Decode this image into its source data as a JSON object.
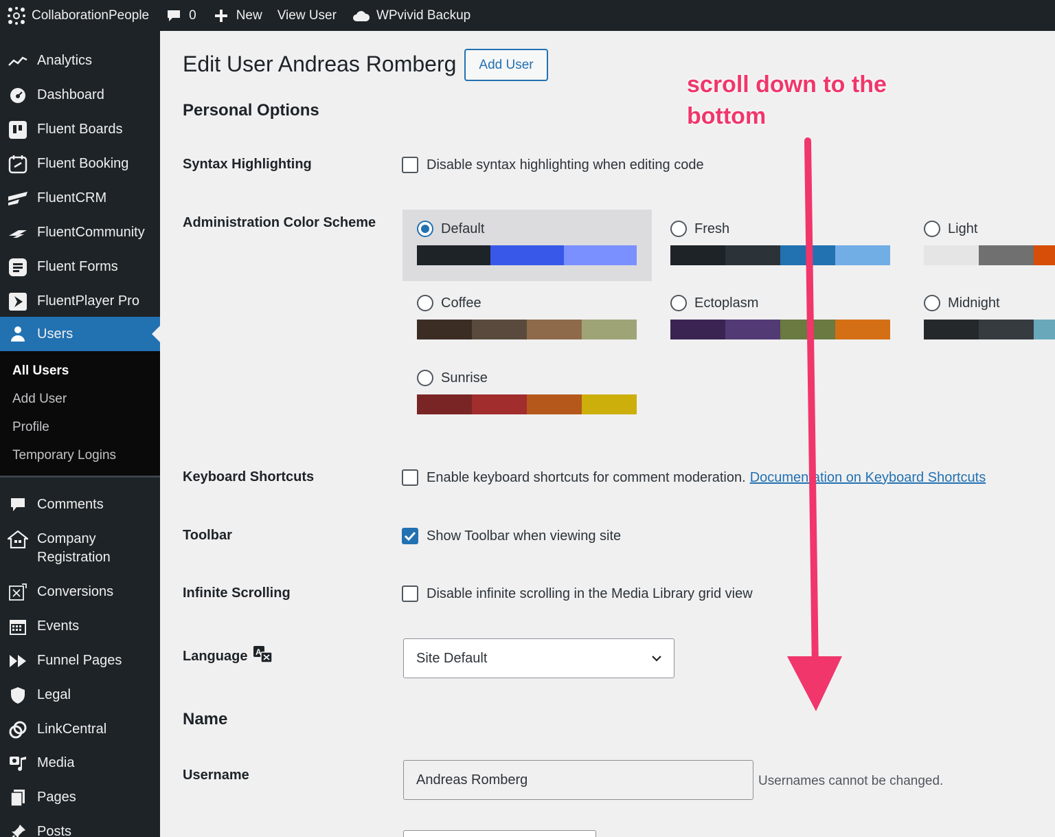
{
  "adminbar": {
    "site_name": "CollaborationPeople",
    "comments_count": "0",
    "new_label": "New",
    "view_user_label": "View User",
    "backup_label": "WPvivid Backup"
  },
  "sidebar": {
    "items": [
      {
        "label": "Analytics",
        "icon": "analytics-icon"
      },
      {
        "label": "Dashboard",
        "icon": "dashboard-icon"
      },
      {
        "label": "Fluent Boards",
        "icon": "fluent-boards-icon"
      },
      {
        "label": "Fluent Booking",
        "icon": "fluent-booking-icon"
      },
      {
        "label": "FluentCRM",
        "icon": "fluentcrm-icon"
      },
      {
        "label": "FluentCommunity",
        "icon": "fluentcommunity-icon"
      },
      {
        "label": "Fluent Forms",
        "icon": "fluent-forms-icon"
      },
      {
        "label": "FluentPlayer Pro",
        "icon": "fluentplayer-icon"
      },
      {
        "label": "Users",
        "icon": "users-icon"
      },
      {
        "label": "Comments",
        "icon": "comments-icon"
      },
      {
        "label": "Company Registration",
        "icon": "company-registration-icon"
      },
      {
        "label": "Conversions",
        "icon": "conversions-icon"
      },
      {
        "label": "Events",
        "icon": "events-icon"
      },
      {
        "label": "Funnel Pages",
        "icon": "funnel-pages-icon"
      },
      {
        "label": "Legal",
        "icon": "legal-icon"
      },
      {
        "label": "LinkCentral",
        "icon": "linkcentral-icon"
      },
      {
        "label": "Media",
        "icon": "media-icon"
      },
      {
        "label": "Pages",
        "icon": "pages-icon"
      },
      {
        "label": "Posts",
        "icon": "posts-icon"
      }
    ],
    "submenu": [
      "All Users",
      "Add User",
      "Profile",
      "Temporary Logins"
    ]
  },
  "page": {
    "title": "Edit User Andreas Romberg",
    "add_user_button": "Add User",
    "personal_options_heading": "Personal Options",
    "name_heading": "Name"
  },
  "options": {
    "syntax": {
      "label": "Syntax Highlighting",
      "text": "Disable syntax highlighting when editing code",
      "checked": false
    },
    "color_scheme_label": "Administration Color Scheme",
    "keyboard": {
      "label": "Keyboard Shortcuts",
      "text": "Enable keyboard shortcuts for comment moderation.",
      "link": "Documentation on Keyboard Shortcuts",
      "checked": false
    },
    "toolbar": {
      "label": "Toolbar",
      "text": "Show Toolbar when viewing site",
      "checked": true
    },
    "infinite": {
      "label": "Infinite Scrolling",
      "text": "Disable infinite scrolling in the Media Library grid view",
      "checked": false
    },
    "language": {
      "label": "Language",
      "value": "Site Default"
    },
    "username": {
      "label": "Username",
      "value": "Andreas Romberg",
      "hint": "Usernames cannot be changed."
    }
  },
  "color_schemes": [
    {
      "name": "Default",
      "selected": true,
      "colors": [
        "#1d2327",
        "#2c3338",
        "#2271b1",
        "#72aee6"
      ]
    },
    {
      "name": "Fresh",
      "selected": false,
      "colors": [
        "#1d2327",
        "#2c3338",
        "#2271b1",
        "#72aee6"
      ]
    },
    {
      "name": "Light",
      "selected": false,
      "colors": [
        "#e5e5e5",
        "#999999",
        "#d64e07",
        "#04a4cc"
      ]
    },
    {
      "name": "Coffee",
      "selected": false,
      "colors": [
        "#46403c",
        "#59524c",
        "#c7a589",
        "#9ea476"
      ]
    },
    {
      "name": "Ectoplasm",
      "selected": false,
      "colors": [
        "#413256",
        "#523f6d",
        "#a3b745",
        "#d46f15"
      ]
    },
    {
      "name": "Midnight",
      "selected": false,
      "colors": [
        "#25282b",
        "#363b3f",
        "#69a8bb",
        "#e14d43"
      ]
    },
    {
      "name": "Sunrise",
      "selected": false,
      "colors": [
        "#b43c38",
        "#cf4944",
        "#dd823b",
        "#ccaf0b"
      ]
    }
  ],
  "annotation": {
    "line1": "scroll down to the",
    "line2": "bottom",
    "color": "#f0366b"
  },
  "colors": {
    "accent": "#2271b1",
    "adminbar_bg": "#1d2327"
  }
}
